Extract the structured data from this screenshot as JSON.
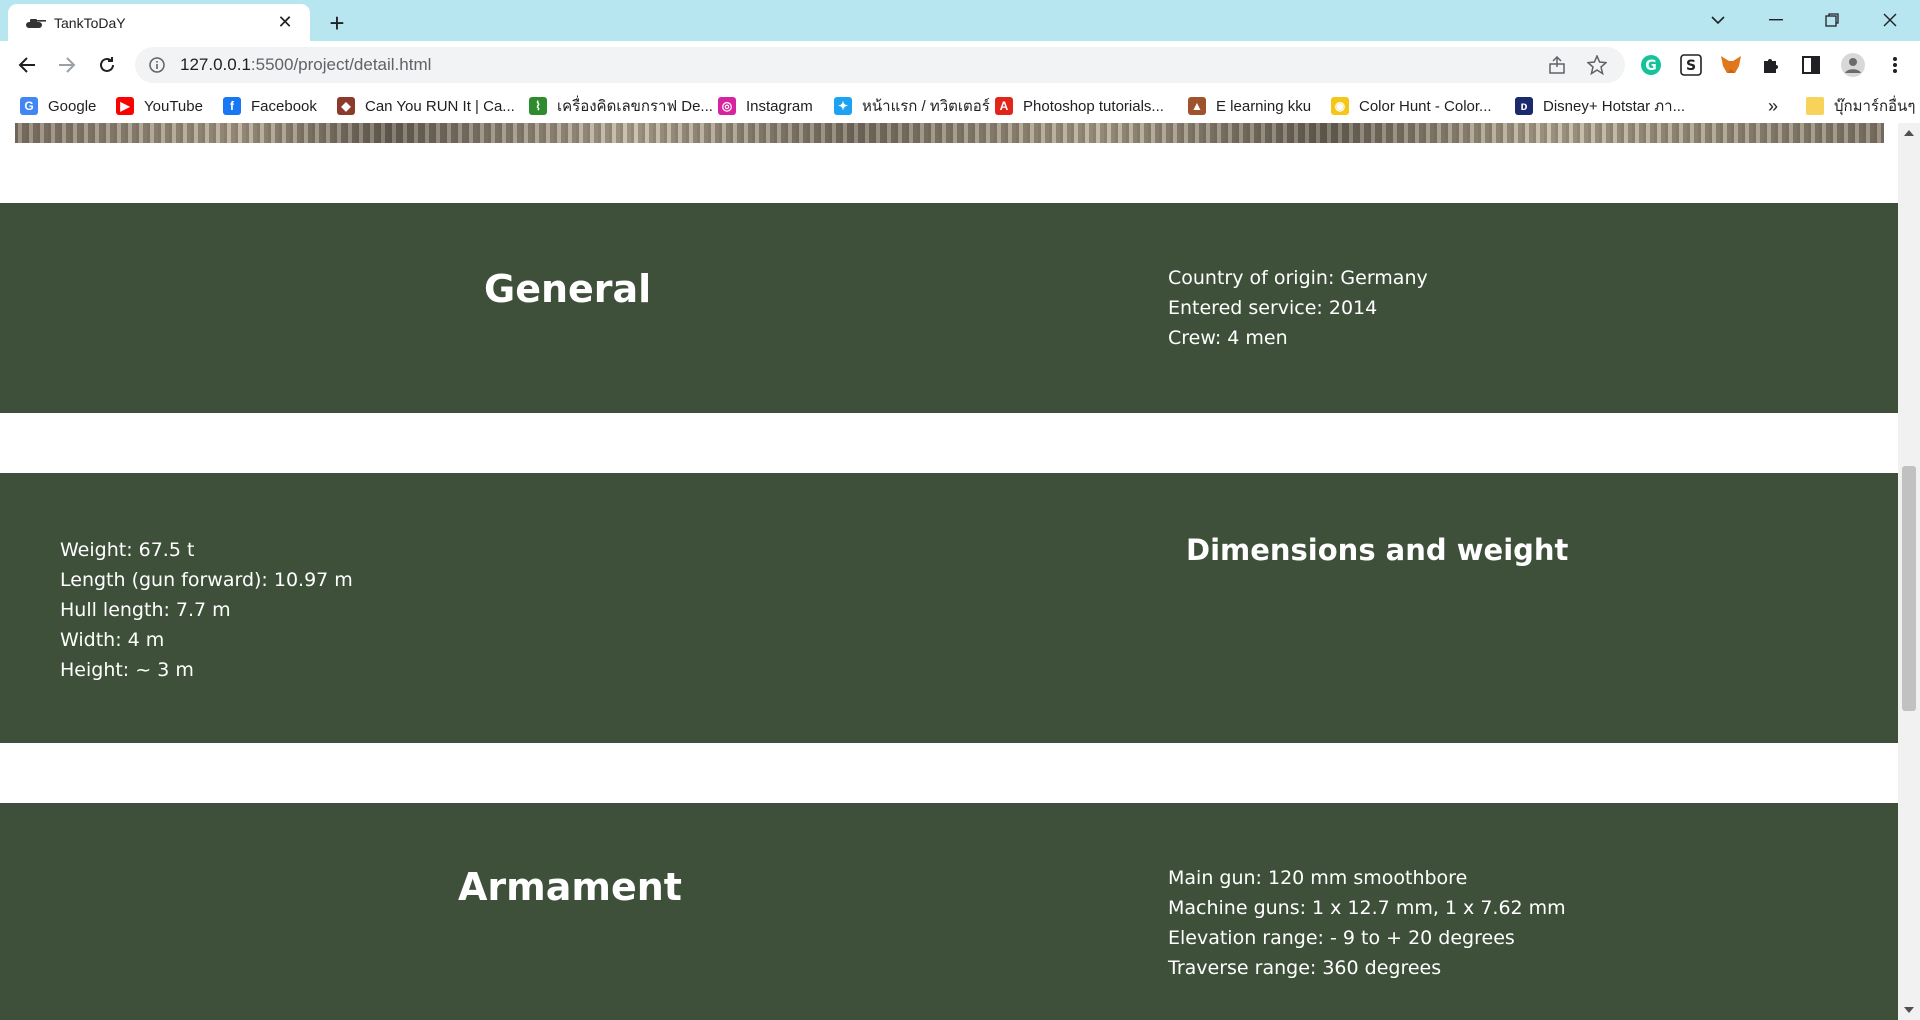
{
  "browser": {
    "tab_title": "TankToDaY",
    "url_host": "127.0.0.1",
    "url_rest": ":5500/project/detail.html",
    "bookmarks": [
      {
        "label": "Google",
        "icon": "google-icon",
        "color": "#4285f4"
      },
      {
        "label": "YouTube",
        "icon": "youtube-icon",
        "color": "#ff0000"
      },
      {
        "label": "Facebook",
        "icon": "facebook-icon",
        "color": "#1877f2"
      },
      {
        "label": "Can You RUN It | Ca...",
        "icon": "canyourunit-icon",
        "color": "#8b3a2b"
      },
      {
        "label": "เครื่องคิดเลขกราฟ De...",
        "icon": "desmos-icon",
        "color": "#2e8b2e"
      },
      {
        "label": "Instagram",
        "icon": "instagram-icon",
        "color": "#d6249f"
      },
      {
        "label": "หน้าแรก / ทวิตเตอร์",
        "icon": "twitter-icon",
        "color": "#1da1f2"
      },
      {
        "label": "Photoshop tutorials...",
        "icon": "adobe-icon",
        "color": "#e1251b"
      },
      {
        "label": "E learning kku",
        "icon": "kku-icon",
        "color": "#a0522d"
      },
      {
        "label": "Color Hunt - Color...",
        "icon": "colorhunt-icon",
        "color": "#f5c518"
      },
      {
        "label": "Disney+ Hotstar ภา...",
        "icon": "disneyhotstar-icon",
        "color": "#1a2a6c"
      }
    ],
    "other_bookmarks": "บุ๊กมาร์กอื่นๆ",
    "overflow_label": "»"
  },
  "page": {
    "general": {
      "title": "General",
      "items": [
        "Country of origin: Germany",
        "Entered service: 2014",
        "Crew: 4 men"
      ]
    },
    "dimensions": {
      "title": "Dimensions and weight",
      "items": [
        "Weight: 67.5 t",
        "Length (gun forward): 10.97 m",
        "Hull length: 7.7 m",
        "Width: 4 m",
        "Height: ~ 3 m"
      ]
    },
    "armament": {
      "title": "Armament",
      "items": [
        "Main gun: 120 mm smoothbore",
        "Machine guns: 1 x 12.7 mm, 1 x 7.62 mm",
        "Elevation range: - 9 to + 20 degrees",
        "Traverse range: 360 degrees"
      ]
    }
  },
  "colors": {
    "section_bg": "#3e503a",
    "tabstrip_bg": "#b8e6f0"
  }
}
